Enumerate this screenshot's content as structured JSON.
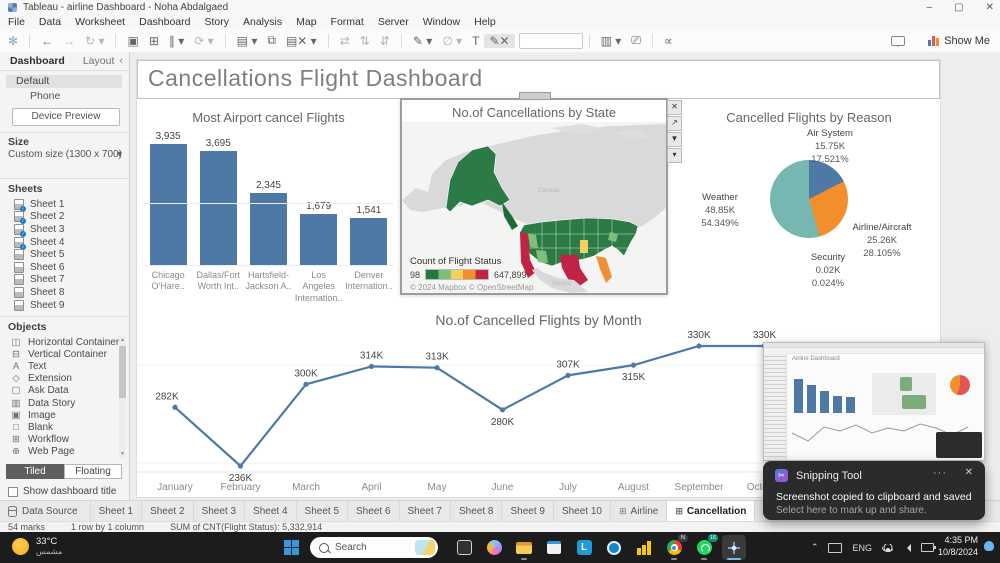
{
  "window": {
    "title": "Tableau - airline Dashboard - Noha Abdalgaed",
    "controls": {
      "minimize": "–",
      "maximize": "▢",
      "close": "✕"
    }
  },
  "menu_items": [
    "File",
    "Data",
    "Worksheet",
    "Dashboard",
    "Story",
    "Analysis",
    "Map",
    "Format",
    "Server",
    "Window",
    "Help"
  ],
  "toolbar": {
    "show_me": "Show Me"
  },
  "sidebar": {
    "tab_dashboard": "Dashboard",
    "tab_layout": "Layout",
    "collapse": "‹",
    "device_default": "Default",
    "device_phone": "Phone",
    "device_preview": "Device Preview",
    "size_label": "Size",
    "size_value": "Custom size (1300 x 700)",
    "sheets_label": "Sheets",
    "sheets": [
      {
        "name": "Sheet 1",
        "used": true
      },
      {
        "name": "Sheet 2",
        "used": true
      },
      {
        "name": "Sheet 3",
        "used": true
      },
      {
        "name": "Sheet 4",
        "used": true
      },
      {
        "name": "Sheet 5",
        "used": false
      },
      {
        "name": "Sheet 6",
        "used": false
      },
      {
        "name": "Sheet 7",
        "used": false
      },
      {
        "name": "Sheet 8",
        "used": false
      },
      {
        "name": "Sheet 9",
        "used": false
      }
    ],
    "objects_label": "Objects",
    "objects": [
      "Horizontal Container",
      "Vertical Container",
      "Text",
      "Extension",
      "Ask Data",
      "Data Story",
      "Image",
      "Blank",
      "Workflow",
      "Web Page"
    ],
    "tiled": "Tiled",
    "floating": "Floating",
    "show_dashboard_title": "Show dashboard title"
  },
  "dashboard_title": "Cancellations Flight Dashboard",
  "chart_data": [
    {
      "type": "bar",
      "title": "Most Airport cancel Flights",
      "categories": [
        "Chicago O'Hare..",
        "Dallas/Fort Worth Int..",
        "Hartsfield-Jackson A..",
        "Los Angeles Internation..",
        "Denver Internation.."
      ],
      "values": [
        3935,
        3695,
        2345,
        1679,
        1541
      ],
      "value_labels": [
        "3,935",
        "3,695",
        "2,345",
        "1,679",
        "1,541"
      ],
      "ylim": [
        0,
        4100
      ],
      "bar_color": "#4e79a7",
      "grid": "faint horizontal"
    },
    {
      "type": "heatmap",
      "subtype": "choropleth-map",
      "title": "No.of Cancellations by State",
      "legend_title": "Count of Flight Status",
      "legend_min": "98",
      "legend_max": "647,899",
      "legend_colors": [
        "#1f7a3c",
        "#7fbf7b",
        "#f2d05c",
        "#f28e2b",
        "#c02442"
      ],
      "attribution": "© 2024 Mapbox © OpenStreetMap",
      "geo_labels": [
        "Canada",
        "Mexico"
      ],
      "notes": "US states shaded green (low) to red (high); California and Texas red, Florida orange, a midwest state yellow, Alaska green"
    },
    {
      "type": "pie",
      "title": "Cancelled Flights by Reason",
      "slices": [
        {
          "label": "Air System",
          "value_label": "15.75K",
          "pct": 17.521,
          "pct_label": "17.521%",
          "color": "#4e79a7"
        },
        {
          "label": "Airline/Aircraft",
          "value_label": "25.26K",
          "pct": 28.105,
          "pct_label": "28.105%",
          "color": "#f28e2b"
        },
        {
          "label": "Security",
          "value_label": "0.02K",
          "pct": 0.024,
          "pct_label": "0.024%",
          "color": "#e15759"
        },
        {
          "label": "Weather",
          "value_label": "48.85K",
          "pct": 54.349,
          "pct_label": "54.349%",
          "color": "#76b7b2"
        }
      ],
      "legend_position": "labels around pie"
    },
    {
      "type": "line",
      "title": "No.of Cancelled Flights by Month",
      "x": [
        "January",
        "February",
        "March",
        "April",
        "May",
        "June",
        "July",
        "August",
        "September",
        "October"
      ],
      "values_k": [
        282,
        236,
        300,
        314,
        313,
        280,
        307,
        315,
        330,
        330
      ],
      "value_labels": [
        "282K",
        "236K",
        "300K",
        "314K",
        "313K",
        "280K",
        "307K",
        "315K",
        "330K",
        "330K"
      ],
      "label_positions": [
        "above",
        "below",
        "above",
        "above",
        "above",
        "below",
        "above",
        "below",
        "above",
        "above"
      ],
      "line_color": "#4e79a7",
      "note": "November/December region hidden behind screenshot preview overlay"
    }
  ],
  "sheet_tabs": {
    "data_source": "Data Source",
    "tabs": [
      "Sheet 1",
      "Sheet 2",
      "Sheet 3",
      "Sheet 4",
      "Sheet 5",
      "Sheet 6",
      "Sheet 7",
      "Sheet 8",
      "Sheet 9",
      "Sheet 10"
    ],
    "grid_tabs": [
      "Airline",
      "Cancellation"
    ],
    "active": "Cancellation"
  },
  "status_bar": {
    "marks": "54 marks",
    "rows": "1 row by 1 column",
    "sum": "SUM of CNT(Flight Status): 5,332,914"
  },
  "taskbar": {
    "weather_temp": "33°C",
    "weather_desc": "مشمس",
    "search_text": "Search",
    "chrome_badge": "N",
    "whatsapp_badge": "16",
    "tray": {
      "lang": "ENG",
      "time": "4:35 PM",
      "date": "10/8/2024"
    }
  },
  "notification": {
    "app": "Snipping Tool",
    "line1": "Screenshot copied to clipboard and saved",
    "line2": "Select here to mark up and share.",
    "menu": "···",
    "close": "✕"
  },
  "preview": {
    "title": "Airline Dashboard"
  }
}
